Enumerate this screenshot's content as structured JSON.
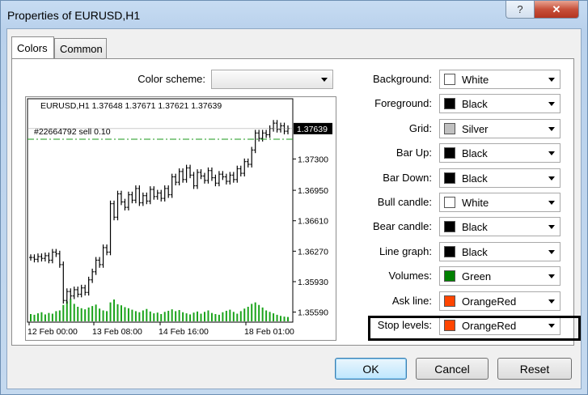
{
  "window": {
    "title": "Properties of EURUSD,H1",
    "help_label": "?",
    "close_label": "✕"
  },
  "tabs": [
    {
      "label": "Colors",
      "active": true
    },
    {
      "label": "Common",
      "active": false
    }
  ],
  "color_scheme": {
    "label": "Color scheme:",
    "value": ""
  },
  "colors": [
    {
      "label": "Background:",
      "value": "White",
      "swatch": "#ffffff"
    },
    {
      "label": "Foreground:",
      "value": "Black",
      "swatch": "#000000"
    },
    {
      "label": "Grid:",
      "value": "Silver",
      "swatch": "#c0c0c0"
    },
    {
      "label": "Bar Up:",
      "value": "Black",
      "swatch": "#000000"
    },
    {
      "label": "Bar Down:",
      "value": "Black",
      "swatch": "#000000"
    },
    {
      "label": "Bull candle:",
      "value": "White",
      "swatch": "#ffffff"
    },
    {
      "label": "Bear candle:",
      "value": "Black",
      "swatch": "#000000"
    },
    {
      "label": "Line graph:",
      "value": "Black",
      "swatch": "#000000"
    },
    {
      "label": "Volumes:",
      "value": "Green",
      "swatch": "#008000"
    },
    {
      "label": "Ask line:",
      "value": "OrangeRed",
      "swatch": "#ff4500"
    },
    {
      "label": "Stop levels:",
      "value": "OrangeRed",
      "swatch": "#ff4500"
    }
  ],
  "preview": {
    "header": "EURUSD,H1  1.37648 1.37671 1.37621 1.37639",
    "order_label": "#22664792 sell 0.10",
    "current_price": "1.37639",
    "price_ticks": [
      "1.37300",
      "1.36950",
      "1.36610",
      "1.36270",
      "1.35930",
      "1.35590"
    ],
    "time_ticks": [
      "12 Feb 00:00",
      "13 Feb 08:00",
      "14 Feb 16:00",
      "18 Feb 01:00"
    ],
    "closes": [
      1.362,
      1.3618,
      1.3621,
      1.3619,
      1.3622,
      1.3617,
      1.3626,
      1.3624,
      1.3612,
      1.3572,
      1.3582,
      1.3577,
      1.3584,
      1.3579,
      1.3586,
      1.3581,
      1.3595,
      1.3604,
      1.3617,
      1.3612,
      1.3631,
      1.3626,
      1.368,
      1.3665,
      1.3691,
      1.3682,
      1.3676,
      1.369,
      1.3684,
      1.3697,
      1.3681,
      1.3689,
      1.3683,
      1.3696,
      1.3688,
      1.3692,
      1.3686,
      1.3697,
      1.369,
      1.371,
      1.3704,
      1.3716,
      1.3707,
      1.372,
      1.3712,
      1.37,
      1.3715,
      1.3711,
      1.3706,
      1.3717,
      1.3709,
      1.3703,
      1.3713,
      1.371,
      1.3705,
      1.3712,
      1.3707,
      1.3719,
      1.3714,
      1.3727,
      1.3724,
      1.374,
      1.3759,
      1.3753,
      1.3759,
      1.3757,
      1.3764,
      1.377,
      1.3763,
      1.3767,
      1.3761,
      1.3764
    ],
    "volumes": [
      0.2,
      0.18,
      0.22,
      0.25,
      0.19,
      0.23,
      0.21,
      0.28,
      0.3,
      0.45,
      0.55,
      0.62,
      0.48,
      0.4,
      0.36,
      0.33,
      0.38,
      0.42,
      0.46,
      0.35,
      0.3,
      0.28,
      0.52,
      0.6,
      0.47,
      0.44,
      0.39,
      0.36,
      0.32,
      0.28,
      0.25,
      0.3,
      0.34,
      0.27,
      0.22,
      0.24,
      0.2,
      0.26,
      0.29,
      0.33,
      0.28,
      0.31,
      0.25,
      0.22,
      0.19,
      0.24,
      0.27,
      0.21,
      0.26,
      0.3,
      0.23,
      0.2,
      0.18,
      0.25,
      0.29,
      0.32,
      0.26,
      0.21,
      0.28,
      0.35,
      0.4,
      0.48,
      0.52,
      0.45,
      0.38,
      0.3,
      0.26,
      0.22,
      0.18,
      0.15,
      0.13,
      0.12
    ]
  },
  "buttons": {
    "ok": "OK",
    "cancel": "Cancel",
    "reset": "Reset"
  }
}
